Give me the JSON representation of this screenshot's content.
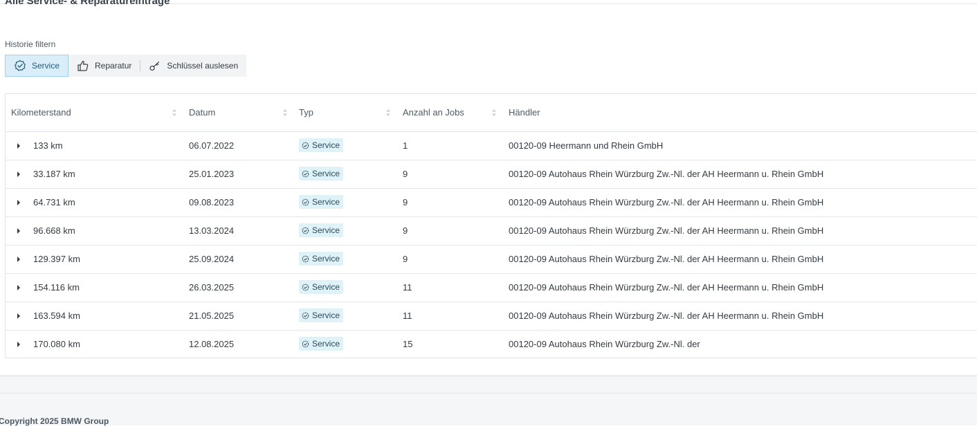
{
  "page": {
    "title": "Alle Service- & Reparatureinträge"
  },
  "filter": {
    "label": "Historie filtern",
    "buttons": [
      {
        "label": "Service",
        "icon": "service-badge-icon",
        "active": true
      },
      {
        "label": "Reparatur",
        "icon": "thumbs-up-icon",
        "active": false
      },
      {
        "label": "Schlüssel auslesen",
        "icon": "key-icon",
        "active": false
      }
    ]
  },
  "table": {
    "columns": [
      "Kilometerstand",
      "Datum",
      "Typ",
      "Anzahl an Jobs",
      "Händler"
    ],
    "rows": [
      {
        "km": "133 km",
        "date": "06.07.2022",
        "type": "Service",
        "jobs": "1",
        "dealer": "00120-09 Heermann und Rhein GmbH"
      },
      {
        "km": "33.187 km",
        "date": "25.01.2023",
        "type": "Service",
        "jobs": "9",
        "dealer": "00120-09 Autohaus Rhein Würzburg Zw.-Nl. der AH Heermann u. Rhein GmbH"
      },
      {
        "km": "64.731 km",
        "date": "09.08.2023",
        "type": "Service",
        "jobs": "9",
        "dealer": "00120-09 Autohaus Rhein Würzburg Zw.-Nl. der AH Heermann u. Rhein GmbH"
      },
      {
        "km": "96.668 km",
        "date": "13.03.2024",
        "type": "Service",
        "jobs": "9",
        "dealer": "00120-09 Autohaus Rhein Würzburg Zw.-Nl. der AH Heermann u. Rhein GmbH"
      },
      {
        "km": "129.397 km",
        "date": "25.09.2024",
        "type": "Service",
        "jobs": "9",
        "dealer": "00120-09 Autohaus Rhein Würzburg Zw.-Nl. der AH Heermann u. Rhein GmbH"
      },
      {
        "km": "154.116 km",
        "date": "26.03.2025",
        "type": "Service",
        "jobs": "11",
        "dealer": "00120-09 Autohaus Rhein Würzburg Zw.-Nl. der AH Heermann u. Rhein GmbH"
      },
      {
        "km": "163.594 km",
        "date": "21.05.2025",
        "type": "Service",
        "jobs": "11",
        "dealer": "00120-09 Autohaus Rhein Würzburg Zw.-Nl. der AH Heermann u. Rhein GmbH"
      },
      {
        "km": "170.080 km",
        "date": "12.08.2025",
        "type": "Service",
        "jobs": "15",
        "dealer": "00120-09 Autohaus Rhein Würzburg Zw.-Nl. der"
      }
    ]
  },
  "footer": {
    "copyright": "Copyright 2025 BMW Group"
  },
  "colors": {
    "accent": "#1c5a7e",
    "badge_bg": "#dff2f8",
    "active_bg": "#d9eef9"
  }
}
